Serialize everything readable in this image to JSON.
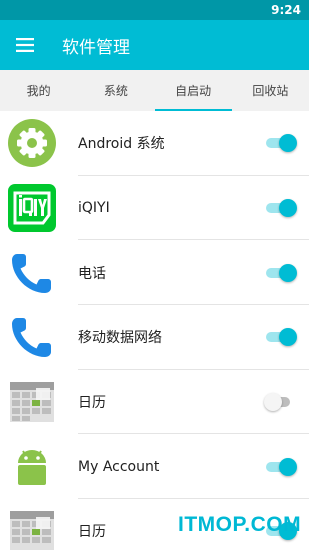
{
  "status_bar": {
    "time": "9:24"
  },
  "app_bar": {
    "title": "软件管理",
    "menu_icon": "menu-icon"
  },
  "tabs": [
    {
      "label": "我的",
      "active": false
    },
    {
      "label": "系统",
      "active": false
    },
    {
      "label": "自启动",
      "active": true
    },
    {
      "label": "回收站",
      "active": false
    }
  ],
  "apps": [
    {
      "name": "Android 系统",
      "icon": "settings-gear-icon",
      "enabled": true
    },
    {
      "name": "iQIYI",
      "icon": "iqiyi-logo-icon",
      "enabled": true
    },
    {
      "name": "电话",
      "icon": "phone-icon",
      "enabled": true
    },
    {
      "name": "移动数据网络",
      "icon": "phone-icon",
      "enabled": true
    },
    {
      "name": "日历",
      "icon": "calendar-icon",
      "enabled": false
    },
    {
      "name": "My Account",
      "icon": "android-robot-icon",
      "enabled": true
    },
    {
      "name": "日历",
      "icon": "calendar-icon",
      "enabled": true
    }
  ],
  "watermark": {
    "text": "ITMOP.COM"
  },
  "colors": {
    "primary": "#00bcd4",
    "primary_dark": "#0097a7",
    "toggle_on_track": "#9ee5ee",
    "toggle_off_track": "#bdbdbd"
  }
}
